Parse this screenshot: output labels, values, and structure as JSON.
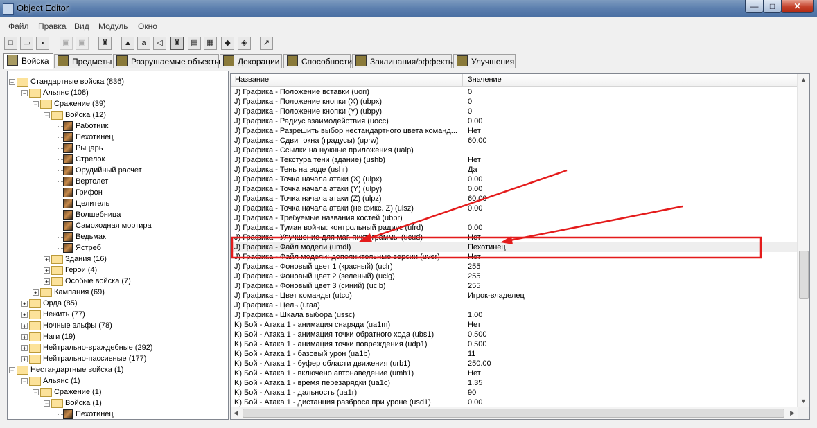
{
  "window": {
    "title": "Object Editor",
    "min_label": "—",
    "max_label": "□",
    "close_label": "✕"
  },
  "menu": [
    "Файл",
    "Правка",
    "Вид",
    "Модуль",
    "Окно"
  ],
  "toolbar_icons": [
    "new-file-icon",
    "open-folder-icon",
    "save-icon",
    "copy-icon",
    "paste-icon",
    "unit-icon",
    "terrain-icon",
    "text-icon",
    "sound-icon",
    "shield-icon",
    "map-icon",
    "tiles-icon",
    "trigger-icon",
    "object-icon",
    "import-icon"
  ],
  "tabs": [
    {
      "label": "Войска",
      "active": true
    },
    {
      "label": "Предметы"
    },
    {
      "label": "Разрушаемые объекты"
    },
    {
      "label": "Декорации"
    },
    {
      "label": "Способности"
    },
    {
      "label": "Заклинания/эффекты"
    },
    {
      "label": "Улучшения"
    }
  ],
  "tree": [
    {
      "label": "Стандартные войска (836)",
      "level": 0,
      "expanded": true,
      "type": "folder"
    },
    {
      "label": "Альянс (108)",
      "level": 1,
      "expanded": true,
      "type": "folder"
    },
    {
      "label": "Сражение (39)",
      "level": 2,
      "expanded": true,
      "type": "folder"
    },
    {
      "label": "Войска (12)",
      "level": 3,
      "expanded": true,
      "type": "folder"
    },
    {
      "label": "Работник",
      "level": 4,
      "type": "unit"
    },
    {
      "label": "Пехотинец",
      "level": 4,
      "type": "unit"
    },
    {
      "label": "Рыцарь",
      "level": 4,
      "type": "unit"
    },
    {
      "label": "Стрелок",
      "level": 4,
      "type": "unit"
    },
    {
      "label": "Орудийный расчет",
      "level": 4,
      "type": "unit"
    },
    {
      "label": "Вертолет",
      "level": 4,
      "type": "unit"
    },
    {
      "label": "Грифон",
      "level": 4,
      "type": "unit"
    },
    {
      "label": "Целитель",
      "level": 4,
      "type": "unit"
    },
    {
      "label": "Волшебница",
      "level": 4,
      "type": "unit"
    },
    {
      "label": "Самоходная мортира",
      "level": 4,
      "type": "unit"
    },
    {
      "label": "Ведьмак",
      "level": 4,
      "type": "unit"
    },
    {
      "label": "Ястреб",
      "level": 4,
      "type": "unit"
    },
    {
      "label": "Здания (16)",
      "level": 3,
      "expanded": false,
      "type": "folder"
    },
    {
      "label": "Герои (4)",
      "level": 3,
      "expanded": false,
      "type": "folder"
    },
    {
      "label": "Особые войска (7)",
      "level": 3,
      "expanded": false,
      "type": "folder"
    },
    {
      "label": "Кампания (69)",
      "level": 2,
      "expanded": false,
      "type": "folder"
    },
    {
      "label": "Орда (85)",
      "level": 1,
      "expanded": false,
      "type": "folder"
    },
    {
      "label": "Нежить (77)",
      "level": 1,
      "expanded": false,
      "type": "folder"
    },
    {
      "label": "Ночные эльфы (78)",
      "level": 1,
      "expanded": false,
      "type": "folder"
    },
    {
      "label": "Наги (19)",
      "level": 1,
      "expanded": false,
      "type": "folder"
    },
    {
      "label": "Нейтрально-враждебные (292)",
      "level": 1,
      "expanded": false,
      "type": "folder"
    },
    {
      "label": "Нейтрально-пассивные (177)",
      "level": 1,
      "expanded": false,
      "type": "folder"
    },
    {
      "label": "Нестандартные войска (1)",
      "level": 0,
      "expanded": true,
      "type": "folder"
    },
    {
      "label": "Альянс (1)",
      "level": 1,
      "expanded": true,
      "type": "folder"
    },
    {
      "label": "Сражение (1)",
      "level": 2,
      "expanded": true,
      "type": "folder"
    },
    {
      "label": "Войска (1)",
      "level": 3,
      "expanded": true,
      "type": "folder"
    },
    {
      "label": "Пехотинец",
      "level": 4,
      "type": "unit"
    }
  ],
  "table": {
    "headers": [
      "Название",
      "Значение"
    ],
    "rows": [
      {
        "name": "J) Графика - Положение вставки (uori)",
        "value": "0"
      },
      {
        "name": "J) Графика - Положение кнопки (X) (ubpx)",
        "value": "0"
      },
      {
        "name": "J) Графика - Положение кнопки (Y) (ubpy)",
        "value": "0"
      },
      {
        "name": "J) Графика - Радиус взаимодействия (uocc)",
        "value": "0.00"
      },
      {
        "name": "J) Графика - Разрешить выбор нестандартного цвета команд...",
        "value": "Нет"
      },
      {
        "name": "J) Графика - Сдвиг окна (градусы) (uprw)",
        "value": "60.00"
      },
      {
        "name": "J) Графика - Ссылки на нужные приложения (ualp)",
        "value": ""
      },
      {
        "name": "J) Графика - Текстура тени (здание) (ushb)",
        "value": "Нет"
      },
      {
        "name": "J) Графика - Тень на воде (ushr)",
        "value": "Да"
      },
      {
        "name": "J) Графика - Точка начала атаки (X) (ulpx)",
        "value": "0.00"
      },
      {
        "name": "J) Графика - Точка начала атаки (Y) (ulpy)",
        "value": "0.00"
      },
      {
        "name": "J) Графика - Точка начала атаки (Z) (ulpz)",
        "value": "60.00"
      },
      {
        "name": "J) Графика - Точка начала атаки (не фикс. Z) (ulsz)",
        "value": "0.00"
      },
      {
        "name": "J) Графика - Требуемые названия костей (ubpr)",
        "value": ""
      },
      {
        "name": "J) Графика - Туман войны: контрольный радиус (ufrd)",
        "value": "0.00"
      },
      {
        "name": "J) Графика - Улучшение для маг. пиктограммы (ucud)",
        "value": "Нет"
      },
      {
        "name": "J) Графика - Файл модели (umdl)",
        "value": "Пехотинец",
        "selected": true
      },
      {
        "name": "J) Графика - Файл модели: дополнительные версии (uver)",
        "value": "Нет"
      },
      {
        "name": "J) Графика - Фоновый цвет 1 (красный) (uclr)",
        "value": "255"
      },
      {
        "name": "J) Графика - Фоновый цвет 2 (зеленый) (uclg)",
        "value": "255"
      },
      {
        "name": "J) Графика - Фоновый цвет 3 (синий) (uclb)",
        "value": "255"
      },
      {
        "name": "J) Графика - Цвет команды (utco)",
        "value": "Игрок-владелец"
      },
      {
        "name": "J) Графика - Цель (utaa)",
        "value": ""
      },
      {
        "name": "J) Графика - Шкала выбора (ussc)",
        "value": "1.00"
      },
      {
        "name": "K) Бой - Атака 1 - анимация снаряда (ua1m)",
        "value": "Нет"
      },
      {
        "name": "K) Бой - Атака 1 - анимация точки обратного хода (ubs1)",
        "value": "0.500"
      },
      {
        "name": "K) Бой - Атака 1 - анимация точки повреждения (udp1)",
        "value": "0.500"
      },
      {
        "name": "K) Бой - Атака 1 - базовый урон (ua1b)",
        "value": "11"
      },
      {
        "name": "K) Бой - Атака 1 - буфер области движения (urb1)",
        "value": "250.00"
      },
      {
        "name": "K) Бой - Атака 1 - включено автонаведение (umh1)",
        "value": "Нет"
      },
      {
        "name": "K) Бой - Атака 1 - время перезарядки (ua1c)",
        "value": "1.35"
      },
      {
        "name": "K) Бой - Атака 1 - дальность (ua1r)",
        "value": "90"
      },
      {
        "name": "K) Бой - Атака 1 - дистанция разброса при уроне (usd1)",
        "value": "0.00"
      }
    ]
  },
  "annotation": {
    "color": "#e41b1b"
  }
}
